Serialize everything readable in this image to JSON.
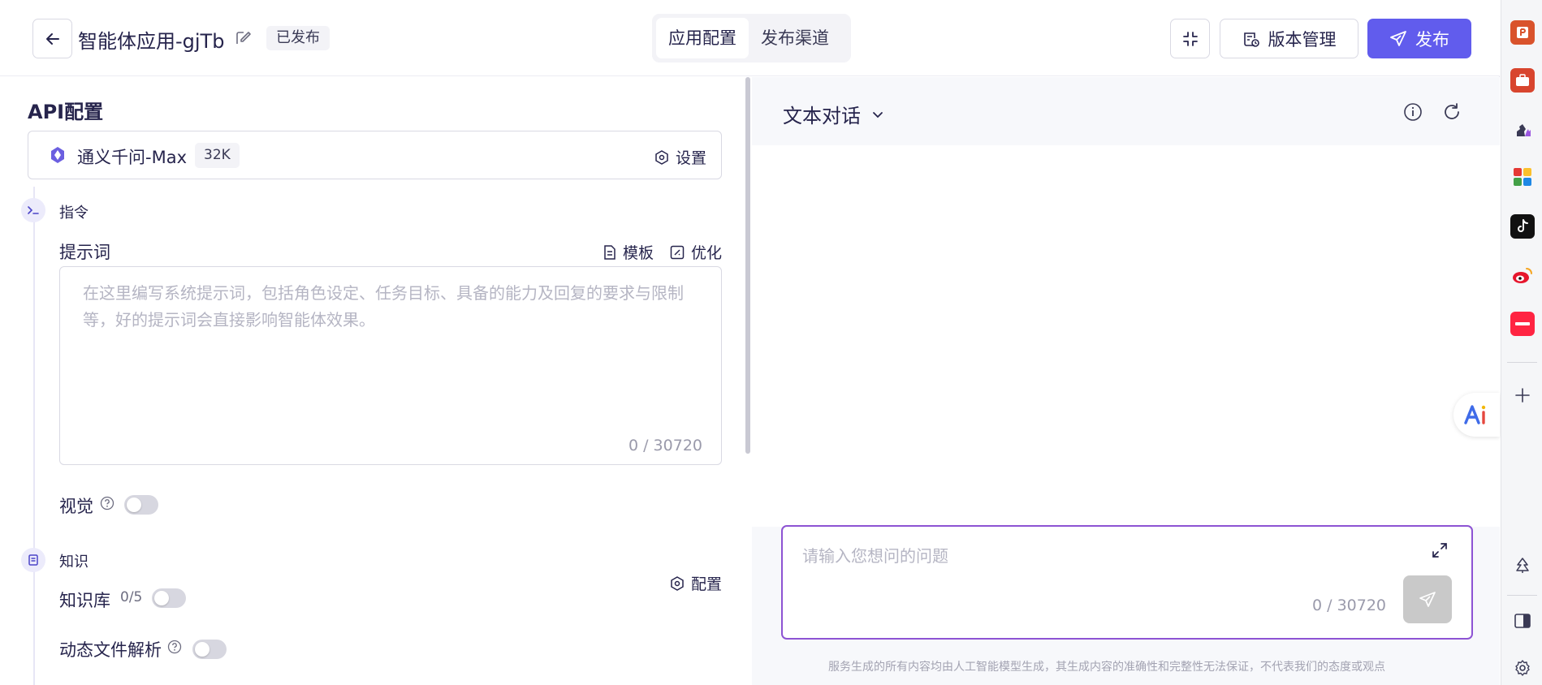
{
  "header": {
    "app_title": "智能体应用-gjTb",
    "status": "已发布",
    "tabs": [
      {
        "label": "应用配置",
        "active": true
      },
      {
        "label": "发布渠道",
        "active": false
      }
    ],
    "version_label": "版本管理",
    "publish_label": "发布"
  },
  "left": {
    "section_title": "API配置",
    "model": {
      "name": "通义千问-Max",
      "context": "32K",
      "settings_label": "设置"
    },
    "instruction": {
      "step_label": "指令",
      "prompt_label": "提示词",
      "template_label": "模板",
      "optimize_label": "优化",
      "placeholder": "在这里编写系统提示词，包括角色设定、任务目标、具备的能力及回复的要求与限制等，好的提示词会直接影响智能体效果。",
      "counter": "0 / 30720"
    },
    "vision": {
      "label": "视觉",
      "enabled": false,
      "config_label": "配置"
    },
    "knowledge": {
      "step_label": "知识",
      "kb_label": "知识库",
      "kb_count": "0/5",
      "kb_enabled": false,
      "dynamic_label": "动态文件解析",
      "dynamic_enabled": false
    }
  },
  "right": {
    "chat_mode": "文本对话",
    "input_placeholder": "请输入您想问的问题",
    "counter": "0 / 30720",
    "disclaimer": "服务生成的所有内容均由人工智能模型生成，其生成内容的准确性和完整性无法保证，不代表我们的态度或观点"
  },
  "colors": {
    "accent": "#615ced",
    "input_border": "#8d53d3",
    "text": "#26244c"
  },
  "edge_sidebar": {
    "icons": [
      "powerpoint-icon",
      "toolbox-icon",
      "chess-icon",
      "office-apps-icon",
      "tiktok-icon",
      "weibo-icon",
      "xiaohongshu-icon",
      "add-icon",
      "tree-icon",
      "split-screen-icon",
      "settings-icon"
    ]
  }
}
